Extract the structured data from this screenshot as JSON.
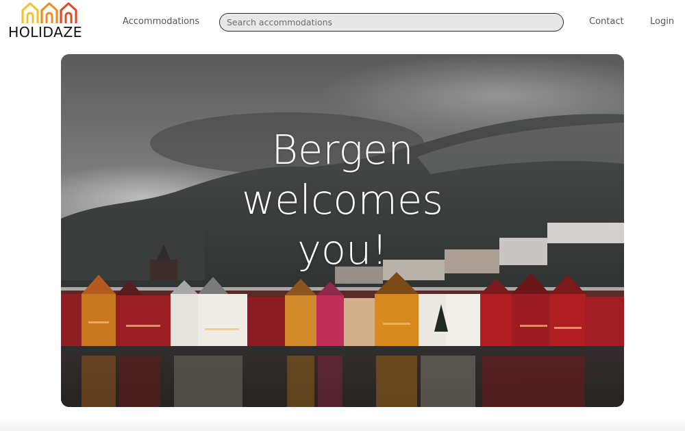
{
  "header": {
    "logo_text": "HOLIDAZE",
    "nav": {
      "accommodations": "Accommodations",
      "contact": "Contact",
      "login": "Login"
    },
    "search": {
      "placeholder": "Search accommodations"
    }
  },
  "hero": {
    "title": "Bergen\nwelcomes\nyou!"
  },
  "colors": {
    "logo_yellow": "#f6c22b",
    "logo_orange": "#f08a24",
    "logo_red": "#e0492a",
    "text_dark": "#111111",
    "nav_text": "#555555"
  }
}
